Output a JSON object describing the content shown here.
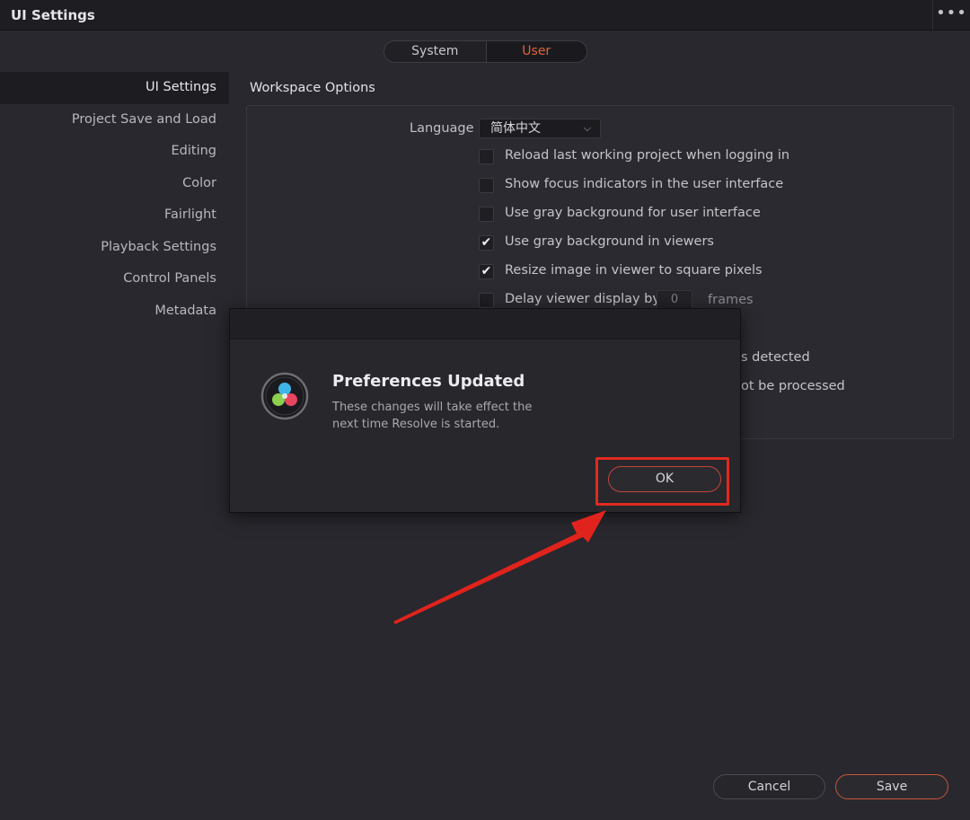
{
  "window": {
    "title": "UI Settings",
    "more_label": "•••"
  },
  "tabs": [
    {
      "label": "System",
      "active": false
    },
    {
      "label": "User",
      "active": true
    }
  ],
  "sidebar": {
    "items": [
      {
        "label": "UI Settings",
        "active": true
      },
      {
        "label": "Project Save and Load"
      },
      {
        "label": "Editing"
      },
      {
        "label": "Color"
      },
      {
        "label": "Fairlight"
      },
      {
        "label": "Playback Settings"
      },
      {
        "label": "Control Panels"
      },
      {
        "label": "Metadata"
      }
    ]
  },
  "workspace": {
    "title": "Workspace Options",
    "language_label": "Language",
    "language_value": "简体中文",
    "options": [
      {
        "label": "Reload last working project when logging in",
        "checked": false
      },
      {
        "label": "Show focus indicators in the user interface",
        "checked": false
      },
      {
        "label": "Use gray background for user interface",
        "checked": false
      },
      {
        "label": "Use gray background in viewers",
        "checked": true
      },
      {
        "label": "Resize image in viewer to square pixels",
        "checked": true
      },
      {
        "label": "Delay viewer display by",
        "checked": false
      }
    ],
    "delay_frames_value": "0",
    "frames_label": "frames",
    "partial_texts": [
      "s detected",
      "ot be processed"
    ]
  },
  "dialog": {
    "title": "Preferences Updated",
    "message": "These changes will take effect the next time Resolve is started.",
    "ok_label": "OK"
  },
  "footer": {
    "cancel_label": "Cancel",
    "save_label": "Save"
  },
  "colors": {
    "accent": "#e0643c",
    "highlight": "#e02a20",
    "background": "#28282e"
  }
}
